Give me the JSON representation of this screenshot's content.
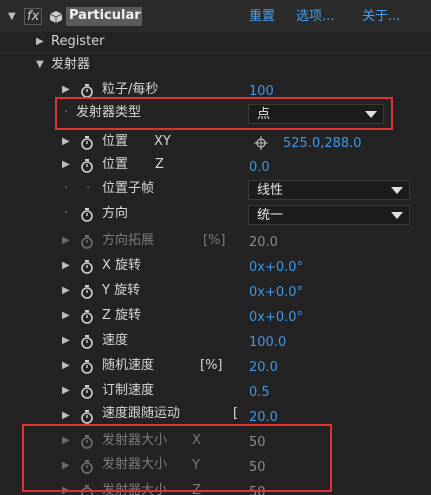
{
  "header": {
    "fx": "fx",
    "effect_name": "Particular",
    "reset": "重置",
    "options": "选项...",
    "about": "关于..."
  },
  "groups": {
    "register": "Register",
    "emitter": "发射器"
  },
  "props": {
    "particles_per_sec": {
      "label": "粒子/每秒",
      "value": "100"
    },
    "emitter_type": {
      "label": "发射器类型",
      "value": "点"
    },
    "position_xy": {
      "label": "位置",
      "suffix": "XY",
      "value": "525.0,288.0"
    },
    "position_z": {
      "label": "位置",
      "suffix": "Z",
      "value": "0.0"
    },
    "position_subframe": {
      "label": "位置子帧",
      "value": "线性"
    },
    "direction": {
      "label": "方向",
      "value": "统一"
    },
    "direction_spread": {
      "label": "方向拓展",
      "suffix": "[%]",
      "value": "20.0"
    },
    "x_rotation": {
      "label": "X 旋转",
      "value": "0x+0.0°"
    },
    "y_rotation": {
      "label": "Y 旋转",
      "value": "0x+0.0°"
    },
    "z_rotation": {
      "label": "Z 旋转",
      "value": "0x+0.0°"
    },
    "velocity": {
      "label": "速度",
      "value": "100.0"
    },
    "velocity_random": {
      "label": "随机速度",
      "suffix": "[%]",
      "value": "20.0"
    },
    "velocity_distribution": {
      "label": "订制速度",
      "value": "0.5"
    },
    "velocity_from_motion": {
      "label": "速度跟随运动",
      "suffix": "[",
      "value": "20.0"
    },
    "emitter_size_x": {
      "label": "发射器大小",
      "suffix": "X",
      "value": "50"
    },
    "emitter_size_y": {
      "label": "发射器大小",
      "suffix": "Y",
      "value": "50"
    },
    "emitter_size_z": {
      "label": "发射器大小",
      "suffix": "Z",
      "value": "50"
    }
  },
  "colors": {
    "background": "#232323",
    "value_blue": "#3f96e8",
    "highlight_red": "#e13232"
  }
}
